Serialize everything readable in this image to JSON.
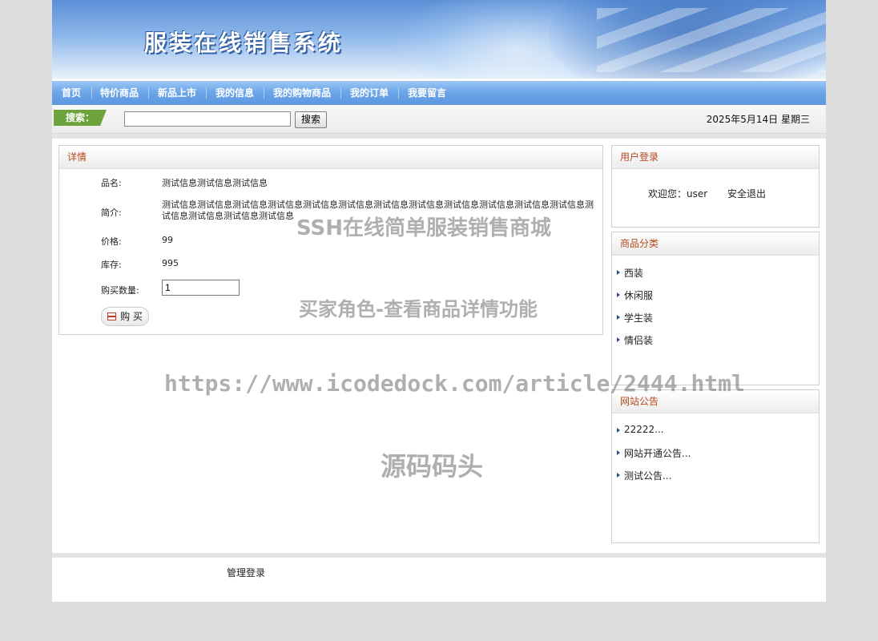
{
  "banner": {
    "title": "服装在线销售系统"
  },
  "nav": {
    "items": [
      "首页",
      "特价商品",
      "新品上市",
      "我的信息",
      "我的购物商品",
      "我的订单",
      "我要留言"
    ]
  },
  "search": {
    "label": "搜索：",
    "value": "",
    "button": "搜索"
  },
  "date": "2025年5月14日 星期三",
  "detail": {
    "header": "详情",
    "name_label": "品名:",
    "name_value": "测试信息测试信息测试信息",
    "desc_label": "简介:",
    "desc_value": "测试信息测试信息测试信息测试信息测试信息测试信息测试信息测试信息测试信息测试信息测试信息测试信息测试信息测试信息测试信息测试信息",
    "price_label": "价格:",
    "price_value": "99",
    "stock_label": "库存:",
    "stock_value": "995",
    "qty_label": "购买数量:",
    "qty_value": "1",
    "buy_button": "购 买"
  },
  "login_panel": {
    "header": "用户登录",
    "welcome": "欢迎您：user",
    "logout": "安全退出"
  },
  "category_panel": {
    "header": "商品分类",
    "items": [
      "西装",
      "休闲服",
      "学生装",
      "情侣装"
    ]
  },
  "notice_panel": {
    "header": "网站公告",
    "items": [
      "22222...",
      "网站开通公告...",
      "测试公告..."
    ]
  },
  "footer": {
    "admin_link": "管理登录"
  },
  "watermarks": {
    "line1": "SSH在线简单服装销售商城",
    "line2": "买家角色-查看商品详情功能",
    "line3": "https://www.icodedock.com/article/2444.html",
    "line4": "源码码头"
  },
  "colors": {
    "nav_blue": "#5d97de",
    "search_green": "#6ca33a",
    "panel_header_text": "#b5471d"
  }
}
